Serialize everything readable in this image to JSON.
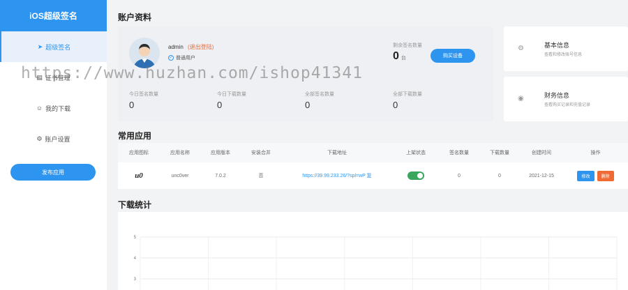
{
  "sidebar": {
    "brand": "iOS超级签名",
    "items": [
      {
        "label": "超级签名",
        "icon": "send-icon",
        "active": true
      },
      {
        "label": "证书管理",
        "icon": "certificate-icon",
        "active": false
      },
      {
        "label": "我的下载",
        "icon": "user-icon",
        "active": false
      },
      {
        "label": "账户设置",
        "icon": "gear-icon",
        "active": false
      }
    ],
    "publish_button": "发布应用"
  },
  "account": {
    "title": "账户资料",
    "username": "admin",
    "logout": "(退出登陆)",
    "user_type": "普通用户",
    "remain_label": "剩余签名数量",
    "remain_value": "0",
    "remain_unit": "台",
    "buy_button": "购买设备",
    "stats": [
      {
        "label": "今日签名数量",
        "value": "0"
      },
      {
        "label": "今日下载数量",
        "value": "0"
      },
      {
        "label": "全部签名数量",
        "value": "0"
      },
      {
        "label": "全部下载数量",
        "value": "0"
      }
    ]
  },
  "info_cards": [
    {
      "title": "基本信息",
      "desc": "查看和修改账号信息",
      "icon": "settings-icon"
    },
    {
      "title": "财务信息",
      "desc": "查看购买记录和充值记录",
      "icon": "wallet-icon"
    }
  ],
  "apps": {
    "title": "常用应用",
    "columns": [
      "应用图标",
      "应用名称",
      "应用版本",
      "安装合并",
      "下载地址",
      "上架状态",
      "签名数量",
      "下载数量",
      "创建时间",
      "操作"
    ],
    "rows": [
      {
        "logo": "u0",
        "name": "unc0ver",
        "version": "7.0.2",
        "merge": "否",
        "url": "https://39.99.233.26/?spl=wP 复",
        "status_on": true,
        "sign_count": "0",
        "download_count": "0",
        "created": "2021-12-15",
        "edit_label": "修改",
        "delete_label": "删除"
      }
    ]
  },
  "download_stats": {
    "title": "下载统计"
  },
  "chart_data": {
    "type": "line",
    "title": "下载统计",
    "y_ticks": [
      "5",
      "4",
      "3"
    ],
    "ylim": [
      0,
      5
    ],
    "grid": true
  },
  "watermark": "https://www.huzhan.com/ishop41341",
  "colors": {
    "accent": "#2d95f0",
    "danger": "#f06a35",
    "success": "#3aa55d"
  }
}
